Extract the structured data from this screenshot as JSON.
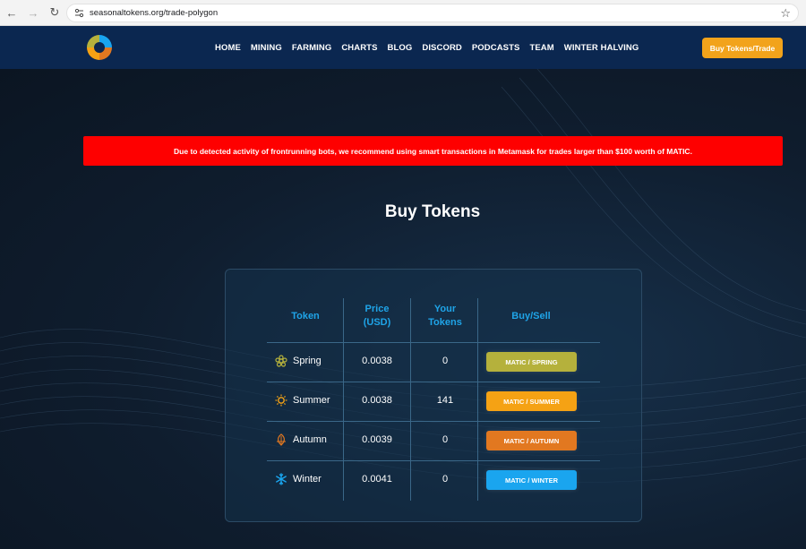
{
  "browser": {
    "url": "seasonaltokens.org/trade-polygon"
  },
  "header": {
    "nav": [
      "HOME",
      "MINING",
      "FARMING",
      "CHARTS",
      "BLOG",
      "DISCORD",
      "PODCASTS",
      "TEAM",
      "WINTER HALVING"
    ],
    "cta_label": "Buy Tokens/Trade"
  },
  "alert": {
    "text": "Due to detected activity of frontrunning bots, we recommend using smart transactions in Metamask for trades larger than $100 worth of MATIC."
  },
  "page": {
    "title": "Buy Tokens"
  },
  "table": {
    "headers": {
      "token": "Token",
      "price_l1": "Price",
      "price_l2": "(USD)",
      "yours_l1": "Your",
      "yours_l2": "Tokens",
      "buysell": "Buy/Sell"
    },
    "rows": [
      {
        "name": "Spring",
        "price": "0.0038",
        "tokens": "0",
        "button": "MATIC / SPRING",
        "color": "#b5b13c",
        "icon": "flower-icon"
      },
      {
        "name": "Summer",
        "price": "0.0038",
        "tokens": "141",
        "button": "MATIC / SUMMER",
        "color": "#f5a214",
        "icon": "sun-icon"
      },
      {
        "name": "Autumn",
        "price": "0.0039",
        "tokens": "0",
        "button": "MATIC / AUTUMN",
        "color": "#e27820",
        "icon": "leaf-icon"
      },
      {
        "name": "Winter",
        "price": "0.0041",
        "tokens": "0",
        "button": "MATIC / WINTER",
        "color": "#1aa5ef",
        "icon": "snowflake-icon"
      }
    ]
  }
}
